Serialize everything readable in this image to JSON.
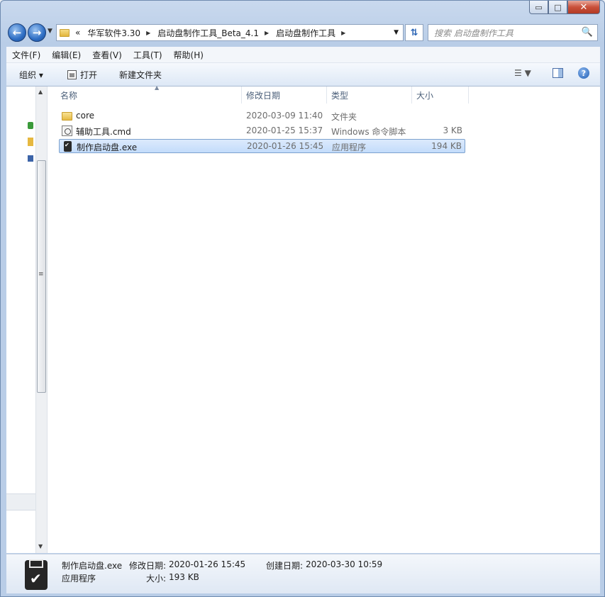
{
  "window": {
    "caption_buttons": {
      "minimize": "▭",
      "maximize": "□",
      "close": "✕"
    }
  },
  "nav": {
    "back_icon": "left-arrow",
    "forward_icon": "right-arrow",
    "address": {
      "overflow": "«",
      "crumbs": [
        "华军软件3.30",
        "启动盘制作工具_Beta_4.1",
        "启动盘制作工具"
      ]
    },
    "search_placeholder": "搜索 启动盘制作工具"
  },
  "menubar": [
    "文件(F)",
    "编辑(E)",
    "查看(V)",
    "工具(T)",
    "帮助(H)"
  ],
  "toolbar": {
    "organize": "组织 ▾",
    "open": "打开",
    "new_folder": "新建文件夹"
  },
  "columns": [
    "名称",
    "修改日期",
    "类型",
    "大小"
  ],
  "files": [
    {
      "name": "core",
      "date": "2020-03-09 11:40",
      "type": "文件夹",
      "size": "",
      "icon": "folder-icon",
      "selected": false
    },
    {
      "name": "辅助工具.cmd",
      "date": "2020-01-25 15:37",
      "type": "Windows 命令脚本",
      "size": "3 KB",
      "icon": "cmd-script-icon",
      "selected": false
    },
    {
      "name": "制作启动盘.exe",
      "date": "2020-01-26 15:45",
      "type": "应用程序",
      "size": "194 KB",
      "icon": "exe-usb-icon",
      "selected": true
    }
  ],
  "details": {
    "name": "制作启动盘.exe",
    "type": "应用程序",
    "modified_label": "修改日期:",
    "modified_value": "2020-01-26 15:45",
    "created_label": "创建日期:",
    "created_value": "2020-03-30 10:59",
    "size_label": "大小:",
    "size_value": "193 KB"
  },
  "colors": {
    "selection_fill": "#c3dcfb",
    "selection_border": "#7da2ce",
    "header_text": "#4c607a"
  }
}
